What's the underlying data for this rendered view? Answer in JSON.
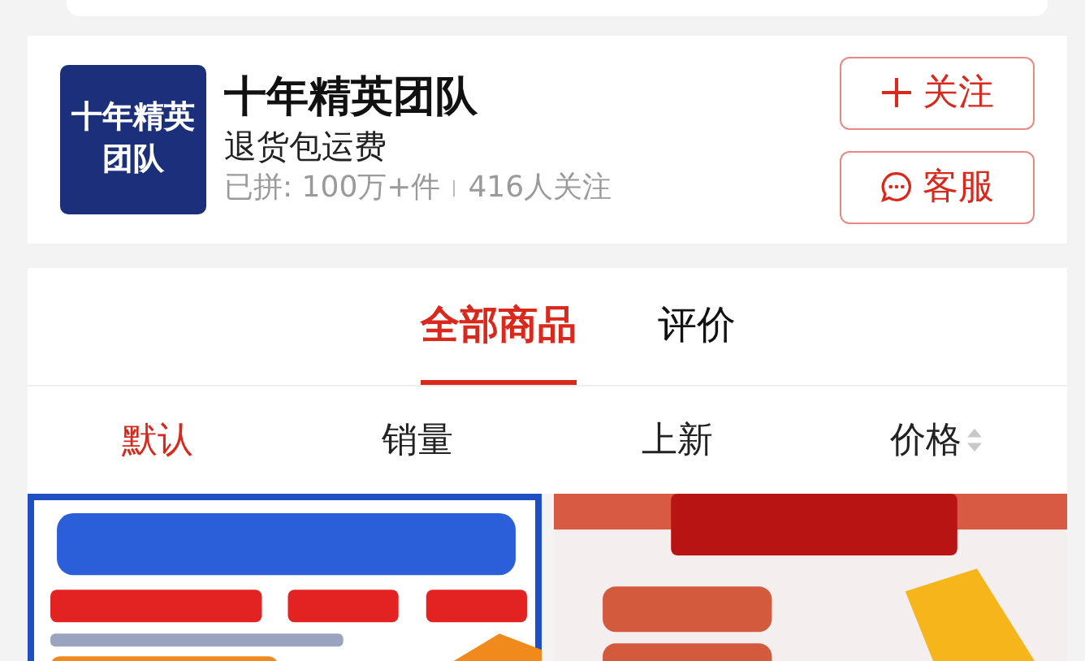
{
  "store": {
    "logo_lines": [
      "十年精英",
      "团队"
    ],
    "name": "十年精英团队",
    "tagline": "退货包运费",
    "sales": "已拼: 100万+件",
    "followers": "416人关注",
    "buttons": [
      {
        "kind": "follow",
        "label": "关注"
      },
      {
        "kind": "service",
        "label": "客服"
      }
    ]
  },
  "tabs": [
    {
      "label": "全部商品",
      "selected": true
    },
    {
      "label": "评价",
      "selected": false
    }
  ],
  "sort_options": [
    {
      "label": "默认",
      "selected": true,
      "sortable": false
    },
    {
      "label": "销量",
      "selected": false,
      "sortable": false
    },
    {
      "label": "上新",
      "selected": false,
      "sortable": false
    },
    {
      "label": "价格",
      "selected": false,
      "sortable": true
    }
  ]
}
